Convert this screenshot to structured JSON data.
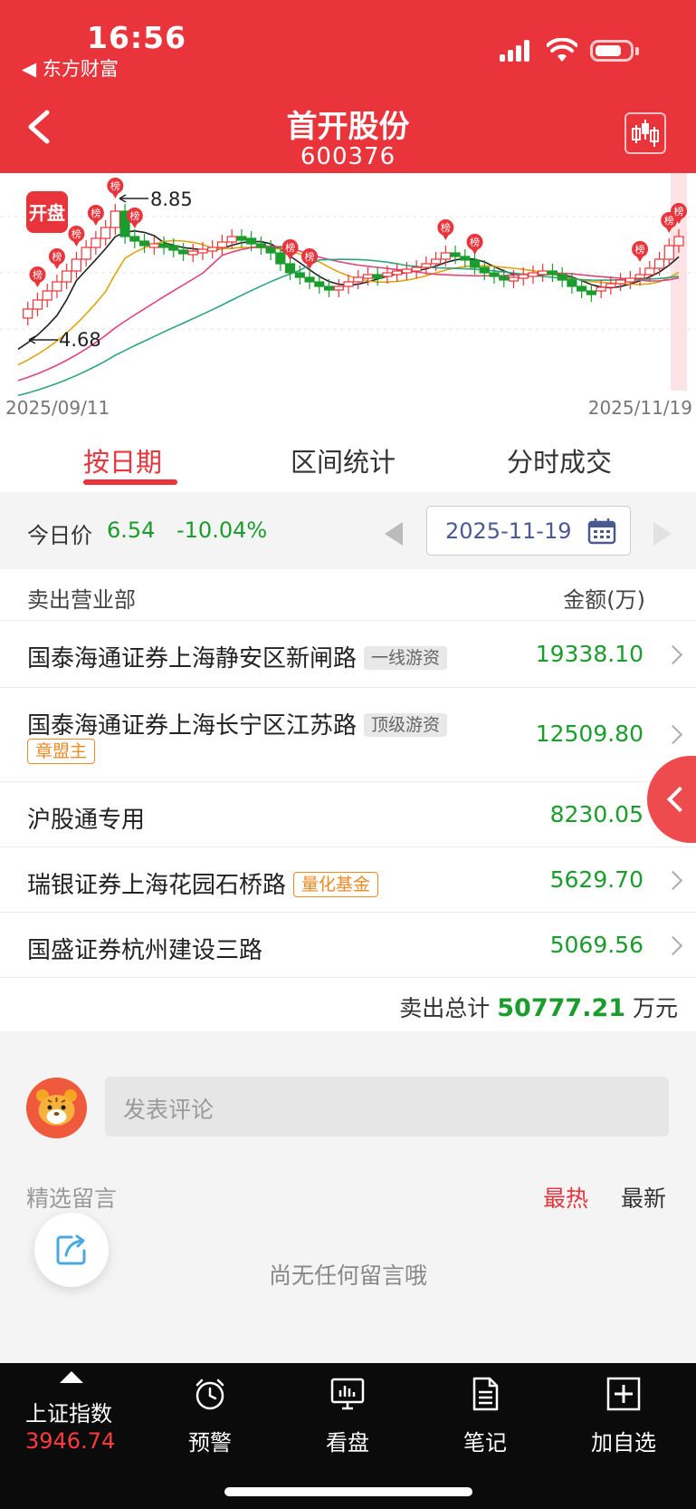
{
  "status_bar": {
    "time": "16:56",
    "back_app": "◀ 东方财富"
  },
  "header": {
    "title": "首开股份",
    "code": "600376"
  },
  "chart": {
    "open_badge": "开盘",
    "rank_marker": "榜",
    "high_label": "8.85",
    "low_label": "4.68",
    "date_start": "2025/09/11",
    "date_end": "2025/11/19",
    "colors": {
      "rise": "#e8343a",
      "fall": "#1a9d2c"
    }
  },
  "chart_data": {
    "type": "candlestick",
    "x_range": [
      "2025/09/11",
      "2025/11/19"
    ],
    "y_range": [
      4.68,
      8.85
    ],
    "annotations": [
      {
        "label": "8.85",
        "type": "high"
      },
      {
        "label": "4.68",
        "type": "low"
      }
    ]
  },
  "tabs": [
    {
      "label": "按日期",
      "active": true
    },
    {
      "label": "区间统计",
      "active": false
    },
    {
      "label": "分时成交",
      "active": false
    }
  ],
  "price_row": {
    "label": "今日价",
    "price": "6.54",
    "change": "-10.04%",
    "date": "2025-11-19"
  },
  "table": {
    "header_name": "卖出营业部",
    "header_amount": "金额(万)",
    "rows": [
      {
        "name": "国泰海通证券上海静安区新闸路",
        "tag": "一线游资",
        "tag_style": "gray",
        "amount": "19338.10"
      },
      {
        "name": "国泰海通证券上海长宁区江苏路",
        "tag": "顶级游资",
        "tag_style": "gray",
        "tag2": "章盟主",
        "amount": "12509.80"
      },
      {
        "name": "沪股通专用",
        "amount": "8230.05"
      },
      {
        "name": "瑞银证券上海花园石桥路",
        "tag": "量化基金",
        "tag_style": "orange",
        "amount": "5629.70"
      },
      {
        "name": "国盛证券杭州建设三路",
        "amount": "5069.56"
      }
    ],
    "total_label": "卖出总计",
    "total_value": "50777.21",
    "total_unit": "万元"
  },
  "comments": {
    "placeholder": "发表评论",
    "section_title": "精选留言",
    "sort_hot": "最热",
    "sort_new": "最新",
    "empty_message": "尚无任何留言哦"
  },
  "bottom_bar": {
    "index_name": "上证指数",
    "index_value": "3946.74",
    "items": [
      {
        "label": "预警",
        "icon": "alarm-clock-icon"
      },
      {
        "label": "看盘",
        "icon": "monitor-chart-icon"
      },
      {
        "label": "笔记",
        "icon": "note-icon"
      },
      {
        "label": "加自选",
        "icon": "add-square-icon"
      }
    ]
  }
}
